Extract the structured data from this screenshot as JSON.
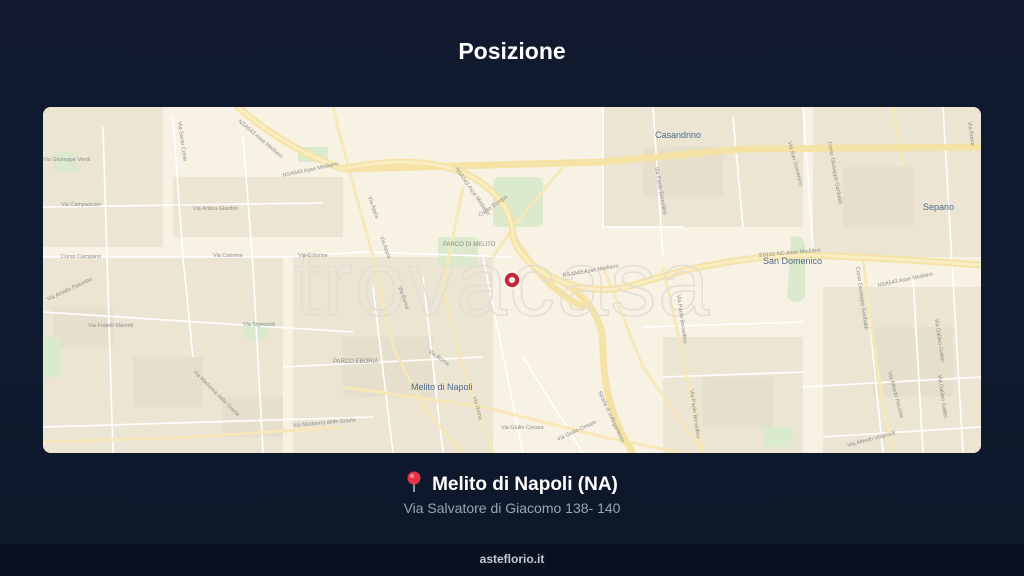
{
  "header": {
    "title": "Posizione"
  },
  "map": {
    "watermark": "trovacasa",
    "towns": {
      "casandrino": "Casandrino",
      "melito": "Melito di Napoli",
      "san_domenico": "San Domenico",
      "sepano": "Sepano"
    },
    "roads": {
      "asse_mediano_w": "NSA543 Asse Mediano",
      "asse_mediano_e": "NSA543 Asse Mediano",
      "asse_mediano_c": "NSA543 Asse Mediano",
      "ss162": "SS162 NC Asse Mediano",
      "nsa543_v": "NSA543 Asse Mediano",
      "corso_europa": "Corso Europa",
      "via_appia": "Via Appia",
      "via_roma_n": "Via Roma",
      "via_roma_s": "Via Roma",
      "via_colonne": "Via Colonne",
      "via_colonne_2": "Via Colonne",
      "corso_campano": "Corso Campano",
      "via_campasciso": "Via Campasciso",
      "via_antica_giardini": "Via Antica Giardini",
      "via_signorelli": "Via Signorelli",
      "via_fratelli_mariotti": "Via Fratelli Mariotti",
      "via_arsello_palumbo": "Via Arsello Palumbo",
      "via_madonna_grazie": "Via Madonna delle Grazie",
      "via_madonna_grazie_2": "Via Madonna delle Grazie",
      "via_giulio_cesare": "Via Giulio Cesare",
      "via_giulio_cesare_2": "Via Giulio Cesare",
      "via_paolo_borsellino": "Via Paolo Borsellino",
      "via_paolo_borsellino_2": "Via Paolo Borsellino",
      "strada_collegamento": "Strada di collegamento",
      "via_san_domenico": "Via San Domenico",
      "corso_giuseppe_garibaldi": "Corso Giuseppe Garibaldi",
      "corso_garibaldi_2": "Corso Giuseppe Garibaldi",
      "via_alfredo_pecchia": "Via Alfredo Pecchia",
      "via_alfredo_volpicelli": "Via Alfredo Volpicelli",
      "via_galileo_galilei": "Via Galileo Galilei",
      "via_galileo_galilei_2": "Via Galileo Galilei",
      "via_giuseppe_verdi": "Via Giuseppe Verdi",
      "via_santo_conte": "Via Santo Conte",
      "via_roma_ne": "Via Roma",
      "via_appia_n": "Via Appia",
      "parco_melito": "PARCO DI MELITO",
      "parco_eboria": "PARCO EBORIA",
      "via_paolo_borsellino_3": "Via Paolo Borsellino",
      "via_roma_e": "Via Roma"
    }
  },
  "location": {
    "city": "Melito di Napoli (NA)",
    "address": "Via Salvatore di Giacomo 138- 140"
  },
  "footer": {
    "brand": "asteflorio.it"
  },
  "colors": {
    "background": "#111a2e",
    "marker": "#c4283b",
    "highway": "#f5e3a6",
    "map_base": "#f8f2e4"
  },
  "icons": {
    "location": "round-pushpin-icon",
    "marker": "map-marker-icon"
  }
}
